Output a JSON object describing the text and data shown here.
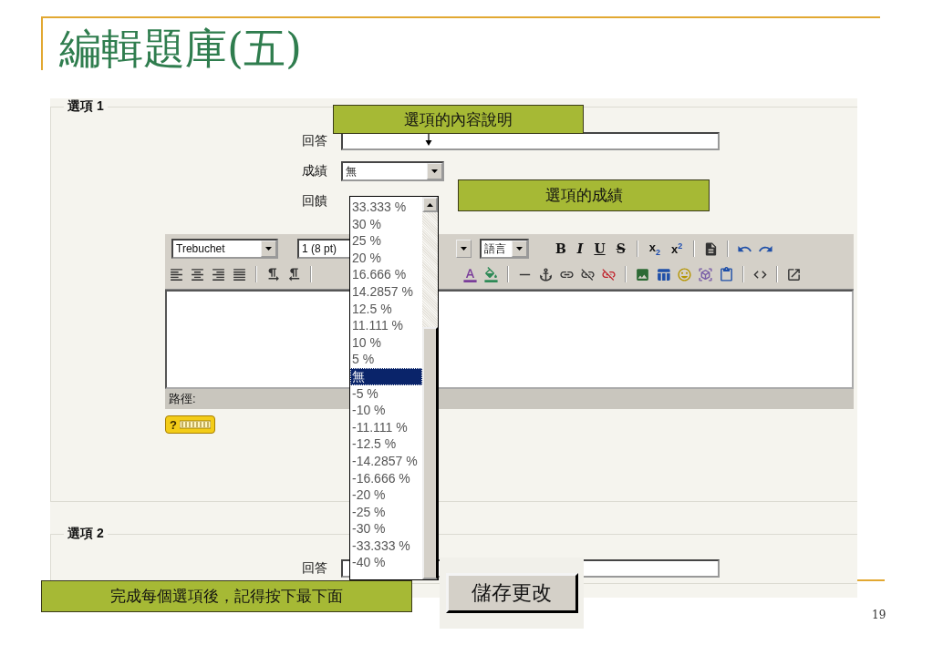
{
  "slide": {
    "title": "編輯題庫(五)",
    "page_number": "19"
  },
  "sections": [
    {
      "legend": "選項 1",
      "fields": [
        {
          "kind": "text",
          "label": "回答"
        },
        {
          "kind": "select",
          "label": "成績",
          "value": "無"
        },
        {
          "kind": "label",
          "label": "回饋"
        }
      ],
      "editor": {
        "font": "Trebuchet",
        "size": "1 (8 pt)",
        "language": "語言",
        "format_buttons": [
          "B",
          "I",
          "U",
          "S"
        ],
        "script_buttons": [
          "x$_{2}$",
          "x$^{2}$"
        ],
        "path_label": "路徑:",
        "help_label": "?"
      }
    },
    {
      "legend": "選項 2",
      "fields": [
        {
          "kind": "text",
          "label": "回答"
        }
      ]
    }
  ],
  "grade_dropdown": {
    "options": [
      {
        "label": "33.333 %",
        "selected": false
      },
      {
        "label": "30 %",
        "selected": false
      },
      {
        "label": "25 %",
        "selected": false
      },
      {
        "label": "20 %",
        "selected": false
      },
      {
        "label": "16.666 %",
        "selected": false
      },
      {
        "label": "14.2857 %",
        "selected": false
      },
      {
        "label": "12.5 %",
        "selected": false
      },
      {
        "label": "11.111 %",
        "selected": false
      },
      {
        "label": "10 %",
        "selected": false
      },
      {
        "label": "5 %",
        "selected": false
      },
      {
        "label": "無",
        "selected": true
      },
      {
        "label": "-5 %",
        "selected": false
      },
      {
        "label": "-10 %",
        "selected": false
      },
      {
        "label": "-11.111 %",
        "selected": false
      },
      {
        "label": "-12.5 %",
        "selected": false
      },
      {
        "label": "-14.2857 %",
        "selected": false
      },
      {
        "label": "-16.666 %",
        "selected": false
      },
      {
        "label": "-20 %",
        "selected": false
      },
      {
        "label": "-25 %",
        "selected": false
      },
      {
        "label": "-30 %",
        "selected": false
      },
      {
        "label": "-33.333 %",
        "selected": false
      },
      {
        "label": "-40 %",
        "selected": false
      }
    ]
  },
  "callouts": [
    {
      "kind": "content",
      "text": "選項的內容說明"
    },
    {
      "kind": "grade",
      "text": "選項的成績"
    },
    {
      "kind": "reminder",
      "text": "完成每個選項後，記得按下最下面"
    }
  ],
  "save_button": {
    "label": "儲存更改"
  }
}
